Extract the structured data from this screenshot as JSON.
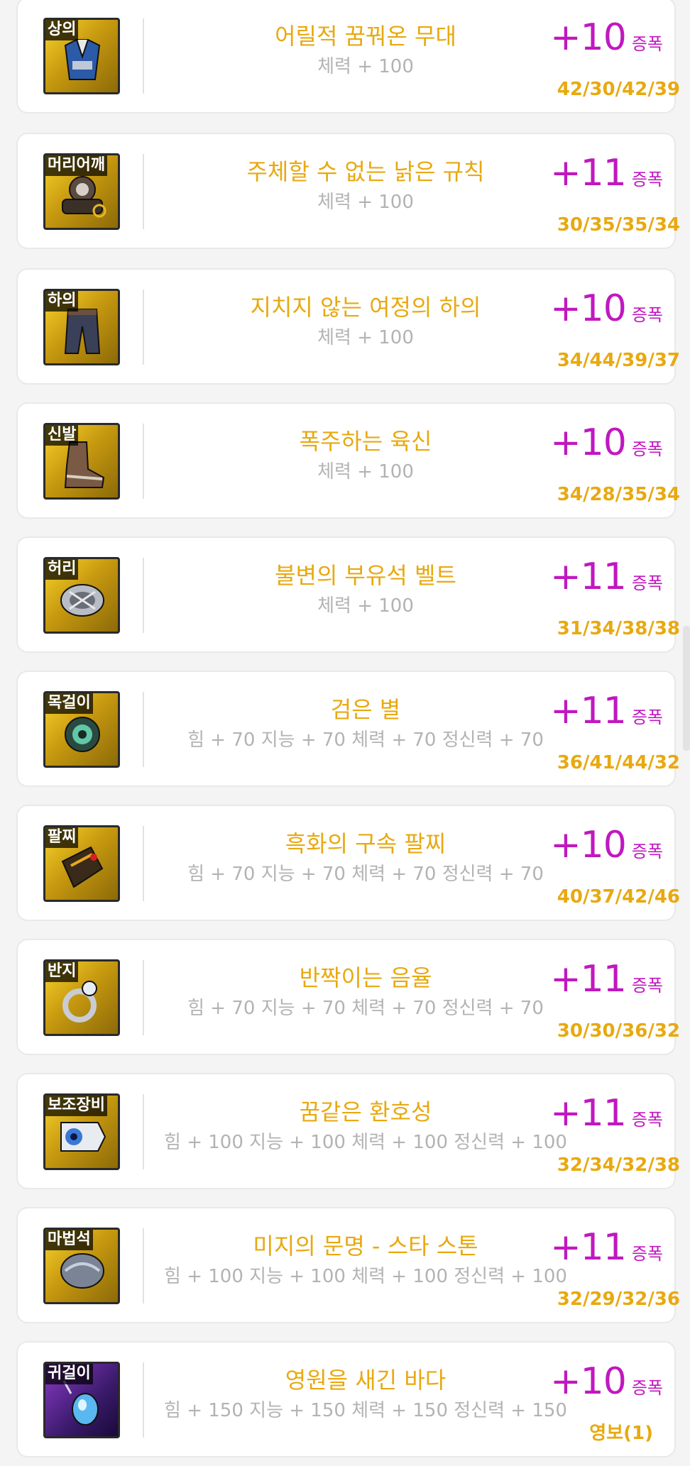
{
  "items": [
    {
      "slot": "상의",
      "name": "어릴적 꿈꿔온 무대",
      "stats": "체력 + 100",
      "stars": "+10",
      "suffix": "증폭",
      "potential": "42/30/42/39"
    },
    {
      "slot": "머리어깨",
      "name": "주체할 수 없는 낡은 규칙",
      "stats": "체력 + 100",
      "stars": "+11",
      "suffix": "증폭",
      "potential": "30/35/35/34"
    },
    {
      "slot": "하의",
      "name": "지치지 않는 여정의 하의",
      "stats": "체력 + 100",
      "stars": "+10",
      "suffix": "증폭",
      "potential": "34/44/39/37"
    },
    {
      "slot": "신발",
      "name": "폭주하는 육신",
      "stats": "체력 + 100",
      "stars": "+10",
      "suffix": "증폭",
      "potential": "34/28/35/34"
    },
    {
      "slot": "허리",
      "name": "불변의 부유석 벨트",
      "stats": "체력 + 100",
      "stars": "+11",
      "suffix": "증폭",
      "potential": "31/34/38/38"
    },
    {
      "slot": "목걸이",
      "name": "검은 별",
      "stats": "힘 + 70 지능 + 70 체력 + 70 정신력 + 70",
      "stars": "+11",
      "suffix": "증폭",
      "potential": "36/41/44/32"
    },
    {
      "slot": "팔찌",
      "name": "흑화의 구속 팔찌",
      "stats": "힘 + 70 지능 + 70 체력 + 70 정신력 + 70",
      "stars": "+10",
      "suffix": "증폭",
      "potential": "40/37/42/46"
    },
    {
      "slot": "반지",
      "name": "반짝이는 음율",
      "stats": "힘 + 70 지능 + 70 체력 + 70 정신력 + 70",
      "stars": "+11",
      "suffix": "증폭",
      "potential": "30/30/36/32"
    },
    {
      "slot": "보조장비",
      "name": "꿈같은 환호성",
      "stats": "힘 + 100 지능 + 100 체력 + 100 정신력 + 100",
      "stars": "+11",
      "suffix": "증폭",
      "potential": "32/34/32/38"
    },
    {
      "slot": "마법석",
      "name": "미지의 문명 - 스타 스톤",
      "stats": "힘 + 100 지능 + 100 체력 + 100 정신력 + 100",
      "stars": "+11",
      "suffix": "증폭",
      "potential": "32/29/32/36"
    },
    {
      "slot": "귀걸이",
      "name": "영원을 새긴 바다",
      "stats": "힘 + 150 지능 + 150 체력 + 150 정신력 + 150",
      "stars": "+10",
      "suffix": "증폭",
      "potential": "영보(1)"
    }
  ],
  "colors": {
    "name": "#e8a910",
    "stats": "#b3b3b3",
    "stars": "#c018c0",
    "potential": "#e8a910"
  }
}
